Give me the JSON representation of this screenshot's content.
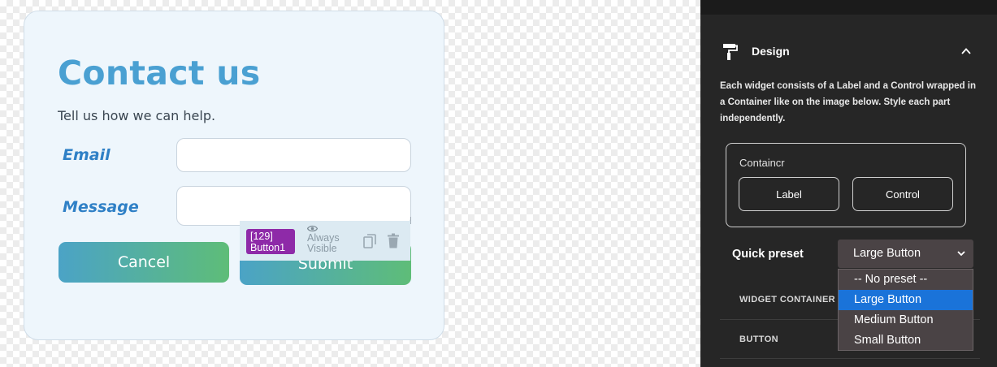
{
  "form": {
    "title": "Contact us",
    "subtitle": "Tell us how we can help.",
    "email_label": "Email",
    "message_label": "Message",
    "email_value": "",
    "message_value": "",
    "cancel_label": "Cancel",
    "submit_label": "Submit"
  },
  "widget_toolbar": {
    "tag_line1": "[129]",
    "tag_line2": "Button1",
    "visibility_line1": "Always",
    "visibility_line2": "Visible",
    "icons": [
      "eye-icon",
      "copy-icon",
      "trash-icon"
    ]
  },
  "panel": {
    "section_title": "Design",
    "section_icon": "paint-roller-icon",
    "description": "Each widget consists of a Label and a Control wrapped in a Container like on the image below. Style each part independently.",
    "diagram": {
      "container_label": "Containcr",
      "label_button": "Label",
      "control_button": "Control"
    },
    "quick_preset_label": "Quick preset",
    "quick_preset_value": "Large Button",
    "preset_options": [
      "-- No preset --",
      "Large Button",
      "Medium Button",
      "Small Button"
    ],
    "selected_option_index": 1,
    "rows": [
      "WIDGET CONTAINER",
      "BUTTON"
    ]
  },
  "colors": {
    "form_title": "#4aa0d2",
    "field_label": "#2f80c6",
    "button_gradient_start": "#4ba3c6",
    "button_gradient_end": "#5ebd78",
    "widget_tag": "#8e2aa8",
    "panel_bg": "#262626",
    "dropdown_selected": "#1a73d9"
  }
}
